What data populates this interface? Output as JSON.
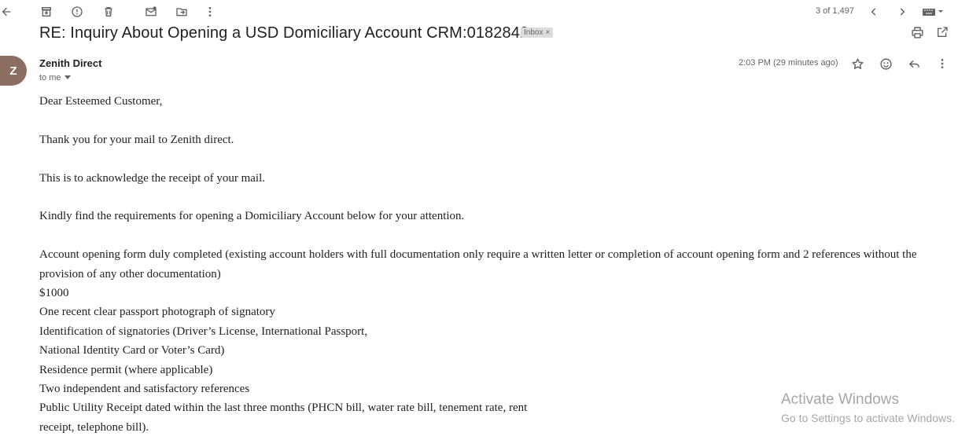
{
  "toolbar": {
    "pager_text": "3 of 1,497"
  },
  "message": {
    "subject": "RE: Inquiry About Opening a USD Domiciliary Account CRM:0182842",
    "label": "Inbox",
    "label_remove": "×",
    "avatar_letter": "Z",
    "sender": "Zenith Direct",
    "recipient": "to me",
    "timestamp": "2:03 PM (29 minutes ago)"
  },
  "body": {
    "greeting": "Dear Esteemed Customer,",
    "para1": "Thank you for your mail to Zenith direct.",
    "para2": "This is to acknowledge the receipt of your mail.",
    "para3": "Kindly find the requirements for opening a Domiciliary Account below for your attention.",
    "lines": [
      "Account opening form duly completed (existing account holders with full documentation only require a written letter or completion of account opening form and 2 references without the provision of any other documentation)",
      "$1000",
      "One recent clear passport photograph of signatory",
      "Identification of signatories (Driver’s License, International Passport,",
      "National Identity Card or Voter’s Card)",
      "Residence permit (where applicable)",
      "Two independent and satisfactory references",
      "Public Utility Receipt dated within the last three months (PHCN bill, water rate bill, tenement rate, rent",
      "receipt, telephone bill)."
    ]
  },
  "watermark": {
    "line1": "Activate Windows",
    "line2": "Go to Settings to activate Windows."
  },
  "icons": [
    "back-arrow-icon",
    "archive-icon",
    "report-spam-icon",
    "delete-icon",
    "mark-unread-icon",
    "move-to-icon",
    "more-vert-icon",
    "chevron-left-icon",
    "chevron-right-icon",
    "keyboard-icon",
    "print-icon",
    "open-new-window-icon",
    "star-icon",
    "emoji-icon",
    "reply-icon"
  ]
}
